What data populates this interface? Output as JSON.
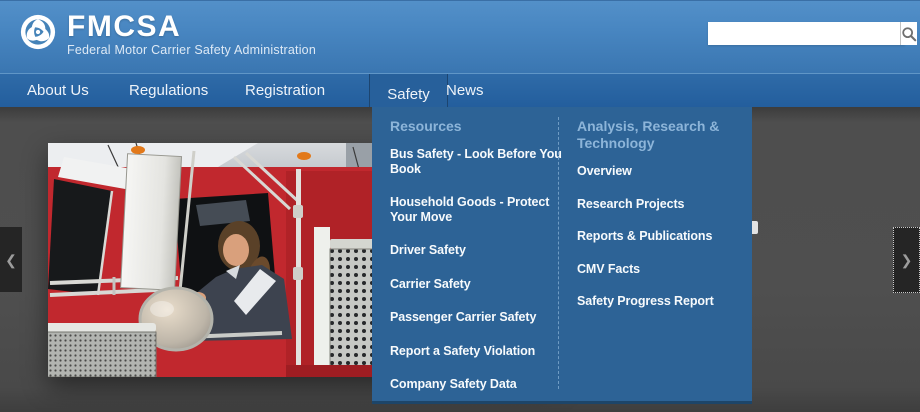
{
  "header": {
    "brand": "FMCSA",
    "subtitle": "Federal Motor Carrier Safety Administration",
    "search": {
      "placeholder": "",
      "button_icon": "magnifier"
    }
  },
  "nav": {
    "items": [
      {
        "label": "About Us",
        "active": false
      },
      {
        "label": "Regulations",
        "active": false
      },
      {
        "label": "Registration",
        "active": false
      },
      {
        "label": "Safety",
        "active": true
      },
      {
        "label": "News",
        "active": false
      }
    ]
  },
  "menu": {
    "columns": [
      {
        "header": "Resources",
        "items": [
          "Bus Safety - Look Before You Book",
          "Household Goods - Protect Your Move",
          "Driver Safety",
          "Carrier Safety",
          "Passenger Carrier Safety",
          "Report a Safety Violation",
          "Company Safety Data"
        ]
      },
      {
        "header": "Analysis, Research & Technology",
        "items": [
          "Overview",
          "Research Projects",
          "Reports & Publications",
          "CMV Facts",
          "Safety Progress Report"
        ]
      }
    ]
  },
  "carousel": {
    "prev_icon": "❮",
    "next_icon": "❯",
    "image_description": "Smiling woman leaning out the driver window of a red semi truck"
  },
  "colors": {
    "header_blue_top": "#5390c9",
    "header_blue_bottom": "#3a75af",
    "nav_blue": "#2a67a4",
    "dropdown_blue": "#2d6396",
    "menu_header_text": "#8db5d9",
    "menu_item_text": "#f7fafc",
    "carousel_bg": "#4c4c4c",
    "truck_red": "#c1282e"
  }
}
